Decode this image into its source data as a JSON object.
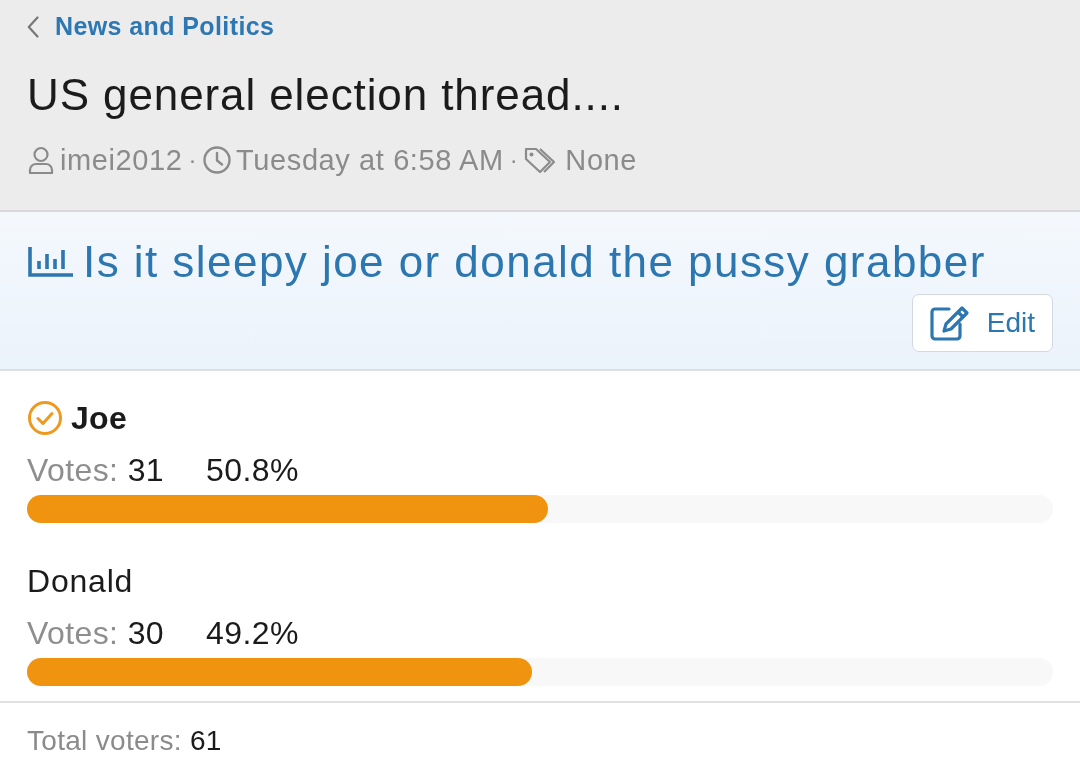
{
  "breadcrumb": {
    "label": "News and Politics"
  },
  "thread": {
    "title": "US general election thread....",
    "meta": [
      {
        "kind": "author",
        "text": "imei2012"
      },
      {
        "kind": "date",
        "separator_before": "·",
        "text": "Tuesday at 6:58 AM"
      },
      {
        "kind": "tags",
        "separator_before": "·",
        "text": "None"
      }
    ]
  },
  "poll": {
    "question": "Is it sleepy joe or donald the pussy grabber",
    "edit_button": "Edit",
    "options": [
      {
        "label": "Joe",
        "selected": true,
        "votes_label": "Votes:",
        "votes": "31",
        "percent": "50.8%",
        "level": 0.508
      },
      {
        "label": "Donald",
        "selected": false,
        "votes_label": "Votes:",
        "votes": "30",
        "percent": "49.2%",
        "level": 0.492
      }
    ],
    "total_label": "Total voters:",
    "total": "61"
  }
}
